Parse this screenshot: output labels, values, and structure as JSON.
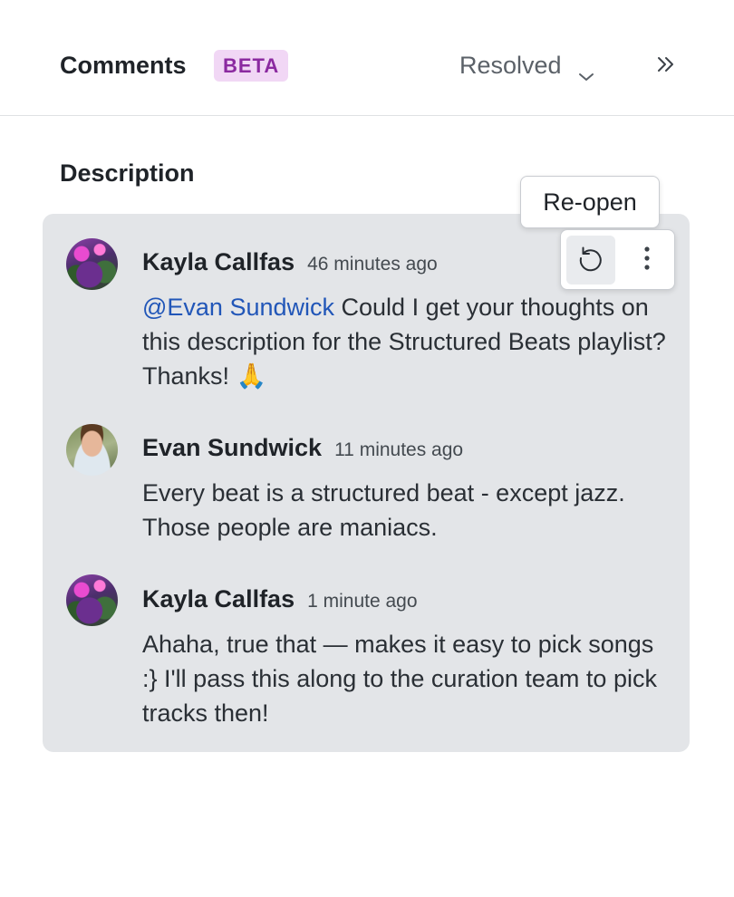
{
  "header": {
    "title": "Comments",
    "badge": "BETA",
    "filter": {
      "selected": "Resolved"
    },
    "icons": {
      "filter_chevron": "chevron-down-icon",
      "collapse": "double-chevron-right-icon"
    }
  },
  "section": {
    "title": "Description"
  },
  "toolbar": {
    "tooltip": "Re-open",
    "reopen_icon": "reopen-icon",
    "more_icon": "more-vertical-icon"
  },
  "thread": {
    "comments": [
      {
        "author": "Kayla Callfas",
        "time": "46 minutes ago",
        "mention": "@Evan Sundwick",
        "text": " Could I get your thoughts on this description for the Structured Beats playlist? Thanks! 🙏"
      },
      {
        "author": "Evan Sundwick",
        "time": "11 minutes ago",
        "text": "Every beat is a structured beat - except jazz. Those people are maniacs."
      },
      {
        "author": "Kayla Callfas",
        "time": "1 minute ago",
        "text": "Ahaha, true that — makes it easy to pick songs :} I'll pass this along to the curation team to pick tracks then!"
      }
    ]
  },
  "colors": {
    "badge_bg": "#f1d7f5",
    "badge_text": "#8b2aa0",
    "thread_bg": "#e3e5e8",
    "mention": "#2156b8"
  }
}
